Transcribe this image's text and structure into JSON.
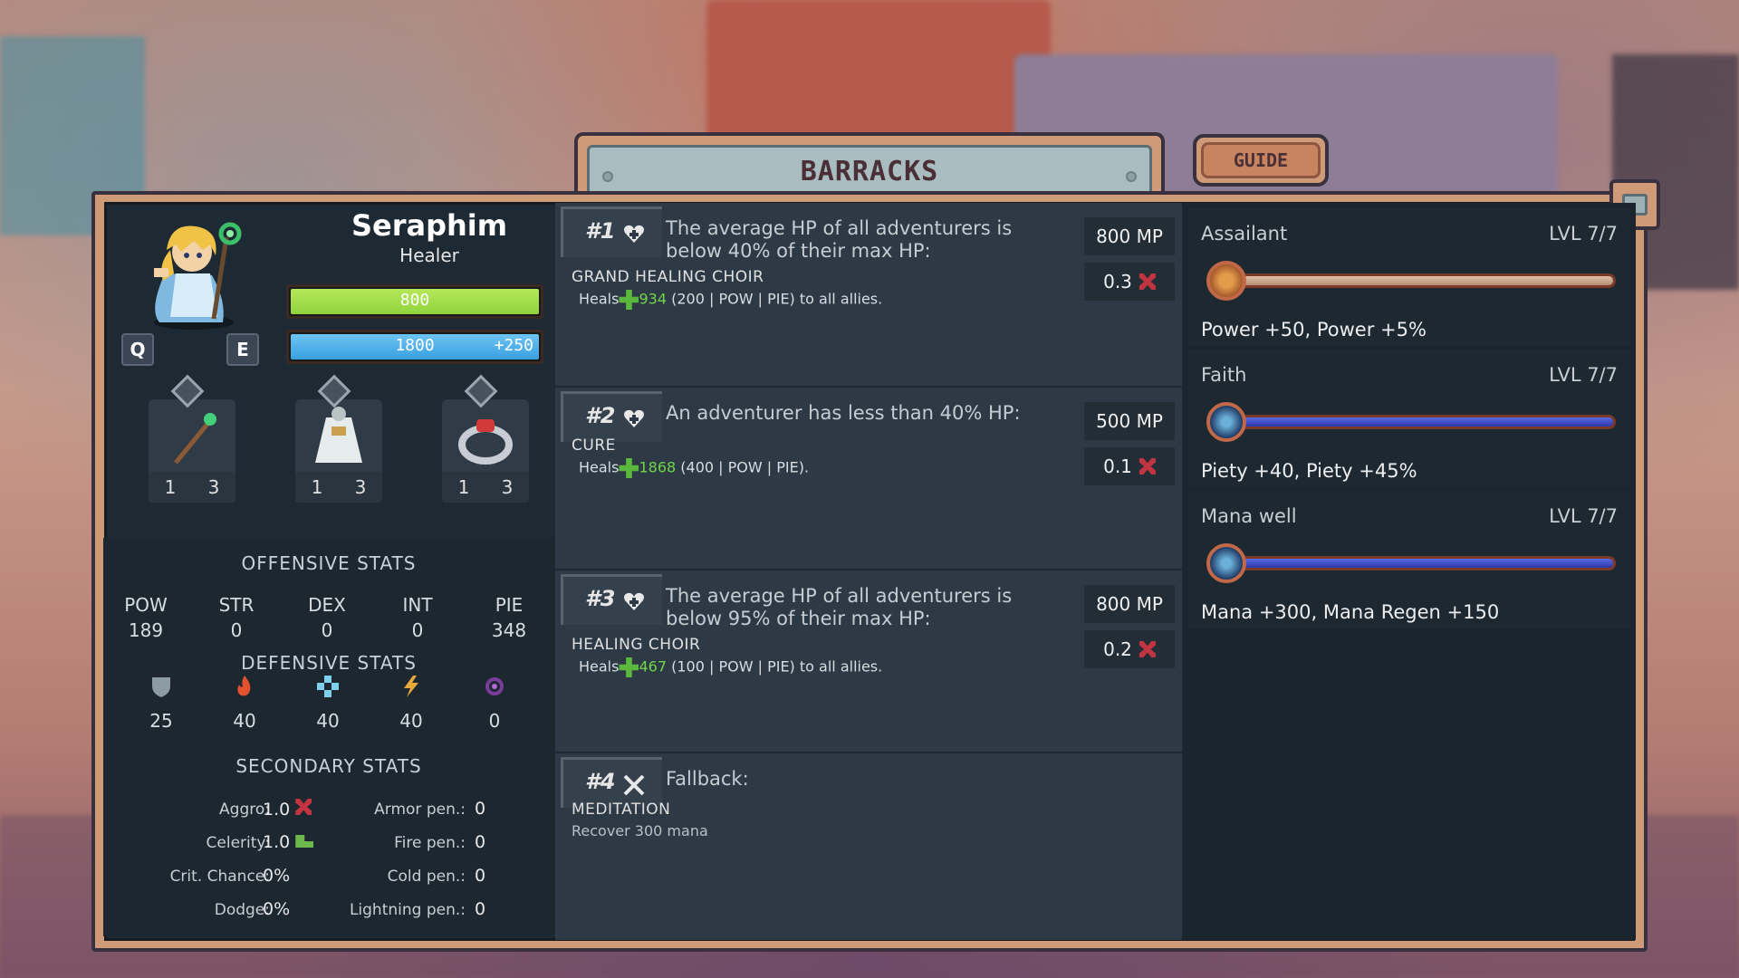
{
  "title": "BARRACKS",
  "guide_label": "GUIDE",
  "hero": {
    "name": "Seraphim",
    "class": "Healer",
    "hp": "800",
    "mp": "1800",
    "mp_bonus": "+250",
    "hp_fill": 1.0,
    "mp_fill": 1.0,
    "key_prev": "Q",
    "key_next": "E",
    "colors": {
      "hp": "#8fd33c",
      "mp": "#3aa0e0"
    }
  },
  "equipment": [
    {
      "icon": "staff-icon",
      "a": "1",
      "b": "3"
    },
    {
      "icon": "robe-icon",
      "a": "1",
      "b": "3"
    },
    {
      "icon": "ring-icon",
      "a": "1",
      "b": "3"
    }
  ],
  "offensive": {
    "title": "OFFENSIVE STATS",
    "stats": [
      {
        "label": "POW",
        "value": "189"
      },
      {
        "label": "STR",
        "value": "0"
      },
      {
        "label": "DEX",
        "value": "0"
      },
      {
        "label": "INT",
        "value": "0"
      },
      {
        "label": "PIE",
        "value": "348"
      }
    ]
  },
  "defensive": {
    "title": "DEFENSIVE STATS",
    "stats": [
      {
        "icon": "armor-shield-icon",
        "value": "25"
      },
      {
        "icon": "fire-resist-icon",
        "value": "40"
      },
      {
        "icon": "cold-resist-icon",
        "value": "40"
      },
      {
        "icon": "lightning-resist-icon",
        "value": "40"
      },
      {
        "icon": "void-resist-icon",
        "value": "0"
      }
    ]
  },
  "secondary": {
    "title": "SECONDARY STATS",
    "left": [
      {
        "label": "Aggro:",
        "value": "1.0"
      },
      {
        "label": "Celerity:",
        "value": "1.0"
      },
      {
        "label": "Crit. Chance:",
        "value": "0%"
      },
      {
        "label": "Dodge:",
        "value": "0%"
      }
    ],
    "right": [
      {
        "label": "Armor pen.:",
        "value": "0"
      },
      {
        "label": "Fire pen.:",
        "value": "0"
      },
      {
        "label": "Cold pen.:",
        "value": "0"
      },
      {
        "label": "Lightning pen.:",
        "value": "0"
      }
    ]
  },
  "tactics": [
    {
      "num": "#1",
      "icon": "heart-icon",
      "condition": "The average HP of all adventurers is below 40% of their max HP:",
      "ability": "GRAND HEALING CHOIR",
      "desc_pre": "Heals",
      "amount": "934",
      "desc_post": "(200 | POW | PIE) to all allies.",
      "mp": "800 MP",
      "cd": "0.3"
    },
    {
      "num": "#2",
      "icon": "heart-icon",
      "condition": "An adventurer has less than 40% HP:",
      "ability": "CURE",
      "desc_pre": "Heals",
      "amount": "1868",
      "desc_post": "(400 | POW | PIE).",
      "mp": "500 MP",
      "cd": "0.1"
    },
    {
      "num": "#3",
      "icon": "heart-icon",
      "condition": "The average HP of all adventurers is below 95% of their max HP:",
      "ability": "HEALING CHOIR",
      "desc_pre": "Heals",
      "amount": "467",
      "desc_post": "(100 | POW | PIE) to all allies.",
      "mp": "800 MP",
      "cd": "0.2"
    },
    {
      "num": "#4",
      "icon": "crossed-swords-icon",
      "condition": "Fallback:",
      "ability": "MEDITATION",
      "desc": "Recover 300 mana"
    }
  ],
  "traits": [
    {
      "name": "Assailant",
      "level": "LVL 7/7",
      "effect": "Power +50, Power +5%",
      "color": "#c9a48a",
      "icon": "sun-orb-icon"
    },
    {
      "name": "Faith",
      "level": "LVL 7/7",
      "effect": "Piety +40, Piety +45%",
      "color": "#3f4fd0",
      "icon": "blue-orb-icon"
    },
    {
      "name": "Mana well",
      "level": "LVL 7/7",
      "effect": "Mana +300, Mana Regen +150",
      "color": "#3f4fd0",
      "icon": "blue-orb-icon"
    }
  ]
}
